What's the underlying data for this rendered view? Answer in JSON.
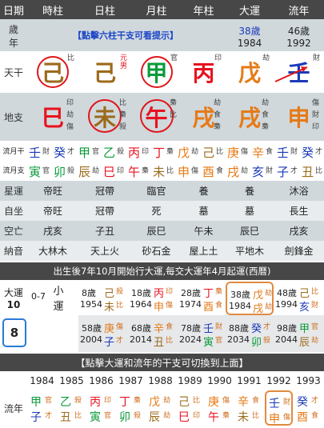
{
  "header": {
    "cols": [
      "日期",
      "時柱",
      "日柱",
      "月柱",
      "年柱",
      "大運",
      "流年"
    ]
  },
  "age_row": {
    "label": [
      "歲",
      "年"
    ],
    "hint": "【點擊六柱干支可看提示】",
    "dayun_age": "38歲",
    "dayun_year": "1984",
    "liunian_age": "46歲",
    "liunian_year": "1992"
  },
  "tiangan": {
    "label": "天干",
    "cells": [
      {
        "char": "己",
        "color": "#9c6a1a",
        "note": "比"
      },
      {
        "char": "己",
        "color": "#9c6a1a",
        "note": "元男",
        "note_color": "#e8121e"
      },
      {
        "char": "甲",
        "color": "#0a9a3a",
        "note": "官"
      },
      {
        "char": "丙",
        "color": "#e8121e",
        "note": "印"
      },
      {
        "char": "戊",
        "color": "#e67a16",
        "note": "劫"
      },
      {
        "char": "壬",
        "color": "#1a3ab8",
        "note": "財"
      }
    ]
  },
  "dizhi": {
    "label": "地支",
    "cells": [
      {
        "char": "巳",
        "color": "#e8121e",
        "notes": [
          "印",
          "劫",
          "傷"
        ]
      },
      {
        "char": "未",
        "color": "#9c6a1a",
        "notes": [
          "比",
          "梟",
          "殺"
        ]
      },
      {
        "char": "午",
        "color": "#e8121e",
        "notes": [
          "梟",
          "比"
        ]
      },
      {
        "char": "戌",
        "color": "#e67a16",
        "notes": [
          "劫",
          "食",
          "梟"
        ]
      },
      {
        "char": "戌",
        "color": "#e67a16",
        "notes": [
          "劫",
          "食",
          "梟"
        ]
      },
      {
        "char": "申",
        "color": "#e67a16",
        "notes": [
          "傷",
          "財",
          "印"
        ]
      }
    ]
  },
  "liuyue": {
    "label": "流月干",
    "row1": [
      [
        "壬",
        "財"
      ],
      [
        "癸",
        "才"
      ],
      [
        "甲",
        "官"
      ],
      [
        "乙",
        "殺"
      ],
      [
        "丙",
        "印"
      ],
      [
        "丁",
        "梟"
      ],
      [
        "戊",
        "劫"
      ],
      [
        "己",
        "比"
      ],
      [
        "庚",
        "傷"
      ],
      [
        "辛",
        "食"
      ],
      [
        "壬",
        "財"
      ],
      [
        "癸",
        "才"
      ]
    ],
    "row2": [
      [
        "寅",
        "官"
      ],
      [
        "卯",
        "殺"
      ],
      [
        "辰",
        "劫"
      ],
      [
        "巳",
        "印"
      ],
      [
        "午",
        "梟"
      ],
      [
        "未",
        "比"
      ],
      [
        "申",
        "傷"
      ],
      [
        "酉",
        "食"
      ],
      [
        "戌",
        "劫"
      ],
      [
        "亥",
        "財"
      ],
      [
        "子",
        "才"
      ],
      [
        "丑",
        "比"
      ]
    ],
    "label2": "流月支"
  },
  "info_rows": [
    {
      "label": "星運",
      "vals": [
        "帝旺",
        "冠帶",
        "臨官",
        "養",
        "養",
        "沐浴"
      ]
    },
    {
      "label": "自坐",
      "vals": [
        "帝旺",
        "冠帶",
        "死",
        "墓",
        "墓",
        "長生"
      ]
    },
    {
      "label": "空亡",
      "vals": [
        "戌亥",
        "子丑",
        "辰巳",
        "午未",
        "辰巳",
        "戌亥"
      ]
    },
    {
      "label": "納音",
      "vals": [
        "大林木",
        "天上火",
        "砂石金",
        "屋上土",
        "平地木",
        "劍鋒金"
      ]
    }
  ],
  "dayun_title": "出生後7年10月開始行大運,每交大運年4月起運(西曆)",
  "dayun": {
    "label": "大運",
    "count": "10",
    "range": "0-7",
    "small": [
      "小",
      "運"
    ],
    "selected_index": "8",
    "row1": [
      {
        "age": "8歲",
        "year": "1954",
        "gan": "己",
        "zhi": "未",
        "n1": "殺",
        "n2": "比"
      },
      {
        "age": "18歲",
        "year": "1964",
        "gan": "丙",
        "zhi": "申",
        "n1": "印",
        "n2": "傷"
      },
      {
        "age": "28歲",
        "year": "1974",
        "gan": "丁",
        "zhi": "酉",
        "n1": "梟",
        "n2": "食"
      },
      {
        "age": "38歲",
        "year": "1984",
        "gan": "戊",
        "zhi": "戌",
        "n1": "劫",
        "n2": "劫"
      },
      {
        "age": "48歲",
        "year": "1994",
        "gan": "己",
        "zhi": "亥",
        "n1": "比",
        "n2": "財"
      }
    ],
    "row2": [
      {
        "age": "58歲",
        "year": "2004",
        "gan": "庚",
        "zhi": "子",
        "n1": "傷",
        "n2": "才"
      },
      {
        "age": "68歲",
        "year": "2014",
        "gan": "辛",
        "zhi": "丑",
        "n1": "食",
        "n2": "比"
      },
      {
        "age": "78歲",
        "year": "2024",
        "gan": "壬",
        "zhi": "寅",
        "n1": "財",
        "n2": "官"
      },
      {
        "age": "88歲",
        "year": "2034",
        "gan": "癸",
        "zhi": "卯",
        "n1": "才",
        "n2": "殺"
      },
      {
        "age": "98歲",
        "year": "2044",
        "gan": "甲",
        "zhi": "辰",
        "n1": "官",
        "n2": "劫"
      }
    ]
  },
  "switch_hint": "【點擊大運和流年的干支可切換到上面】",
  "liunian": {
    "label": "流年",
    "years": [
      "1984",
      "1985",
      "1986",
      "1987",
      "1988",
      "1989",
      "1990",
      "1991",
      "1992",
      "1993"
    ],
    "gan": [
      [
        "甲",
        "官"
      ],
      [
        "乙",
        "殺"
      ],
      [
        "丙",
        "印"
      ],
      [
        "丁",
        "梟"
      ],
      [
        "戊",
        "劫"
      ],
      [
        "己",
        "比"
      ],
      [
        "庚",
        "傷"
      ],
      [
        "辛",
        "食"
      ],
      [
        "壬",
        "財"
      ],
      [
        "癸",
        "才"
      ]
    ],
    "zhi": [
      [
        "子",
        "才"
      ],
      [
        "丑",
        "比"
      ],
      [
        "寅",
        "官"
      ],
      [
        "卯",
        "殺"
      ],
      [
        "辰",
        "劫"
      ],
      [
        "巳",
        "印"
      ],
      [
        "午",
        "梟"
      ],
      [
        "未",
        "比"
      ],
      [
        "申",
        "傷"
      ],
      [
        "酉",
        "食"
      ]
    ]
  }
}
